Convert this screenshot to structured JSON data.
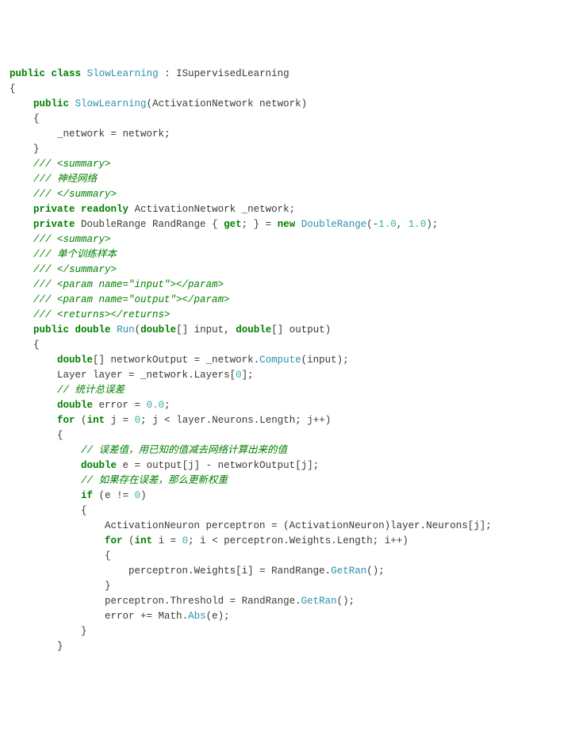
{
  "code": {
    "lines": [
      [
        {
          "c": "kw",
          "t": "public"
        },
        {
          "c": "",
          "t": " "
        },
        {
          "c": "kw",
          "t": "class"
        },
        {
          "c": "",
          "t": " "
        },
        {
          "c": "type",
          "t": "SlowLearning"
        },
        {
          "c": "",
          "t": " "
        },
        {
          "c": "punct",
          "t": ":"
        },
        {
          "c": "",
          "t": " ISupervisedLearning"
        }
      ],
      [
        {
          "c": "punct",
          "t": "{"
        }
      ],
      [
        {
          "c": "",
          "t": "    "
        },
        {
          "c": "kw",
          "t": "public"
        },
        {
          "c": "",
          "t": " "
        },
        {
          "c": "type",
          "t": "SlowLearning"
        },
        {
          "c": "punct",
          "t": "("
        },
        {
          "c": "",
          "t": "ActivationNetwork network"
        },
        {
          "c": "punct",
          "t": ")"
        }
      ],
      [
        {
          "c": "",
          "t": "    "
        },
        {
          "c": "punct",
          "t": "{"
        }
      ],
      [
        {
          "c": "",
          "t": "        _network "
        },
        {
          "c": "op",
          "t": "="
        },
        {
          "c": "",
          "t": " network"
        },
        {
          "c": "punct",
          "t": ";"
        }
      ],
      [
        {
          "c": "",
          "t": "    "
        },
        {
          "c": "punct",
          "t": "}"
        }
      ],
      [
        {
          "c": "",
          "t": ""
        }
      ],
      [
        {
          "c": "",
          "t": "    "
        },
        {
          "c": "comment",
          "t": "/// <summary>"
        }
      ],
      [
        {
          "c": "",
          "t": "    "
        },
        {
          "c": "comment",
          "t": "/// 神经网络"
        }
      ],
      [
        {
          "c": "",
          "t": "    "
        },
        {
          "c": "comment",
          "t": "/// </summary>"
        }
      ],
      [
        {
          "c": "",
          "t": "    "
        },
        {
          "c": "kw",
          "t": "private"
        },
        {
          "c": "",
          "t": " "
        },
        {
          "c": "kw",
          "t": "readonly"
        },
        {
          "c": "",
          "t": " ActivationNetwork _network"
        },
        {
          "c": "punct",
          "t": ";"
        }
      ],
      [
        {
          "c": "",
          "t": ""
        }
      ],
      [
        {
          "c": "",
          "t": "    "
        },
        {
          "c": "kw",
          "t": "private"
        },
        {
          "c": "",
          "t": " DoubleRange RandRange "
        },
        {
          "c": "punct",
          "t": "{"
        },
        {
          "c": "",
          "t": " "
        },
        {
          "c": "kw",
          "t": "get"
        },
        {
          "c": "punct",
          "t": ";"
        },
        {
          "c": "",
          "t": " "
        },
        {
          "c": "punct",
          "t": "}"
        },
        {
          "c": "",
          "t": " "
        },
        {
          "c": "op",
          "t": "="
        },
        {
          "c": "",
          "t": " "
        },
        {
          "c": "kw",
          "t": "new"
        },
        {
          "c": "",
          "t": " "
        },
        {
          "c": "type",
          "t": "DoubleRange"
        },
        {
          "c": "punct",
          "t": "("
        },
        {
          "c": "op",
          "t": "-"
        },
        {
          "c": "num",
          "t": "1.0"
        },
        {
          "c": "punct",
          "t": ","
        },
        {
          "c": "",
          "t": " "
        },
        {
          "c": "num",
          "t": "1.0"
        },
        {
          "c": "punct",
          "t": ")"
        },
        {
          "c": "punct",
          "t": ";"
        }
      ],
      [
        {
          "c": "",
          "t": ""
        }
      ],
      [
        {
          "c": "",
          "t": "    "
        },
        {
          "c": "comment",
          "t": "/// <summary>"
        }
      ],
      [
        {
          "c": "",
          "t": "    "
        },
        {
          "c": "comment",
          "t": "/// 单个训练样本"
        }
      ],
      [
        {
          "c": "",
          "t": "    "
        },
        {
          "c": "comment",
          "t": "/// </summary>"
        }
      ],
      [
        {
          "c": "",
          "t": "    "
        },
        {
          "c": "comment",
          "t": "/// <param name=\"input\"></param>"
        }
      ],
      [
        {
          "c": "",
          "t": "    "
        },
        {
          "c": "comment",
          "t": "/// <param name=\"output\"></param>"
        }
      ],
      [
        {
          "c": "",
          "t": "    "
        },
        {
          "c": "comment",
          "t": "/// <returns></returns>"
        }
      ],
      [
        {
          "c": "",
          "t": "    "
        },
        {
          "c": "kw",
          "t": "public"
        },
        {
          "c": "",
          "t": " "
        },
        {
          "c": "kw",
          "t": "double"
        },
        {
          "c": "",
          "t": " "
        },
        {
          "c": "type",
          "t": "Run"
        },
        {
          "c": "punct",
          "t": "("
        },
        {
          "c": "kw",
          "t": "double"
        },
        {
          "c": "punct",
          "t": "[]"
        },
        {
          "c": "",
          "t": " input"
        },
        {
          "c": "punct",
          "t": ","
        },
        {
          "c": "",
          "t": " "
        },
        {
          "c": "kw",
          "t": "double"
        },
        {
          "c": "punct",
          "t": "[]"
        },
        {
          "c": "",
          "t": " output"
        },
        {
          "c": "punct",
          "t": ")"
        }
      ],
      [
        {
          "c": "",
          "t": "    "
        },
        {
          "c": "punct",
          "t": "{"
        }
      ],
      [
        {
          "c": "",
          "t": "        "
        },
        {
          "c": "kw",
          "t": "double"
        },
        {
          "c": "punct",
          "t": "[]"
        },
        {
          "c": "",
          "t": " networkOutput "
        },
        {
          "c": "op",
          "t": "="
        },
        {
          "c": "",
          "t": " _network"
        },
        {
          "c": "punct",
          "t": "."
        },
        {
          "c": "type",
          "t": "Compute"
        },
        {
          "c": "punct",
          "t": "("
        },
        {
          "c": "",
          "t": "input"
        },
        {
          "c": "punct",
          "t": ")"
        },
        {
          "c": "punct",
          "t": ";"
        }
      ],
      [
        {
          "c": "",
          "t": "        Layer layer "
        },
        {
          "c": "op",
          "t": "="
        },
        {
          "c": "",
          "t": " _network"
        },
        {
          "c": "punct",
          "t": "."
        },
        {
          "c": "",
          "t": "Layers"
        },
        {
          "c": "punct",
          "t": "["
        },
        {
          "c": "num",
          "t": "0"
        },
        {
          "c": "punct",
          "t": "]"
        },
        {
          "c": "punct",
          "t": ";"
        }
      ],
      [
        {
          "c": "",
          "t": "        "
        },
        {
          "c": "comment",
          "t": "// 统计总误差"
        }
      ],
      [
        {
          "c": "",
          "t": "        "
        },
        {
          "c": "kw",
          "t": "double"
        },
        {
          "c": "",
          "t": " error "
        },
        {
          "c": "op",
          "t": "="
        },
        {
          "c": "",
          "t": " "
        },
        {
          "c": "num",
          "t": "0.0"
        },
        {
          "c": "punct",
          "t": ";"
        }
      ],
      [
        {
          "c": "",
          "t": ""
        }
      ],
      [
        {
          "c": "",
          "t": "        "
        },
        {
          "c": "kw",
          "t": "for"
        },
        {
          "c": "",
          "t": " "
        },
        {
          "c": "punct",
          "t": "("
        },
        {
          "c": "kw",
          "t": "int"
        },
        {
          "c": "",
          "t": " j "
        },
        {
          "c": "op",
          "t": "="
        },
        {
          "c": "",
          "t": " "
        },
        {
          "c": "num",
          "t": "0"
        },
        {
          "c": "punct",
          "t": ";"
        },
        {
          "c": "",
          "t": " j "
        },
        {
          "c": "op",
          "t": "<"
        },
        {
          "c": "",
          "t": " layer"
        },
        {
          "c": "punct",
          "t": "."
        },
        {
          "c": "",
          "t": "Neurons"
        },
        {
          "c": "punct",
          "t": "."
        },
        {
          "c": "",
          "t": "Length"
        },
        {
          "c": "punct",
          "t": ";"
        },
        {
          "c": "",
          "t": " j"
        },
        {
          "c": "op",
          "t": "++"
        },
        {
          "c": "punct",
          "t": ")"
        }
      ],
      [
        {
          "c": "",
          "t": "        "
        },
        {
          "c": "punct",
          "t": "{"
        }
      ],
      [
        {
          "c": "",
          "t": "            "
        },
        {
          "c": "comment",
          "t": "// 误差值，用已知的值减去网络计算出来的值"
        }
      ],
      [
        {
          "c": "",
          "t": "            "
        },
        {
          "c": "kw",
          "t": "double"
        },
        {
          "c": "",
          "t": " e "
        },
        {
          "c": "op",
          "t": "="
        },
        {
          "c": "",
          "t": " output"
        },
        {
          "c": "punct",
          "t": "["
        },
        {
          "c": "",
          "t": "j"
        },
        {
          "c": "punct",
          "t": "]"
        },
        {
          "c": "",
          "t": " "
        },
        {
          "c": "op",
          "t": "-"
        },
        {
          "c": "",
          "t": " networkOutput"
        },
        {
          "c": "punct",
          "t": "["
        },
        {
          "c": "",
          "t": "j"
        },
        {
          "c": "punct",
          "t": "]"
        },
        {
          "c": "punct",
          "t": ";"
        }
      ],
      [
        {
          "c": "",
          "t": "            "
        },
        {
          "c": "comment",
          "t": "// 如果存在误差，那么更新权重"
        }
      ],
      [
        {
          "c": "",
          "t": "            "
        },
        {
          "c": "kw",
          "t": "if"
        },
        {
          "c": "",
          "t": " "
        },
        {
          "c": "punct",
          "t": "("
        },
        {
          "c": "",
          "t": "e "
        },
        {
          "c": "op",
          "t": "!="
        },
        {
          "c": "",
          "t": " "
        },
        {
          "c": "num",
          "t": "0"
        },
        {
          "c": "punct",
          "t": ")"
        }
      ],
      [
        {
          "c": "",
          "t": "            "
        },
        {
          "c": "punct",
          "t": "{"
        }
      ],
      [
        {
          "c": "",
          "t": "                ActivationNeuron perceptron "
        },
        {
          "c": "op",
          "t": "="
        },
        {
          "c": "",
          "t": " "
        },
        {
          "c": "punct",
          "t": "("
        },
        {
          "c": "",
          "t": "ActivationNeuron"
        },
        {
          "c": "punct",
          "t": ")"
        },
        {
          "c": "",
          "t": "layer"
        },
        {
          "c": "punct",
          "t": "."
        },
        {
          "c": "",
          "t": "Neurons"
        },
        {
          "c": "punct",
          "t": "["
        },
        {
          "c": "",
          "t": "j"
        },
        {
          "c": "punct",
          "t": "]"
        },
        {
          "c": "punct",
          "t": ";"
        }
      ],
      [
        {
          "c": "",
          "t": ""
        }
      ],
      [
        {
          "c": "",
          "t": "                "
        },
        {
          "c": "kw",
          "t": "for"
        },
        {
          "c": "",
          "t": " "
        },
        {
          "c": "punct",
          "t": "("
        },
        {
          "c": "kw",
          "t": "int"
        },
        {
          "c": "",
          "t": " i "
        },
        {
          "c": "op",
          "t": "="
        },
        {
          "c": "",
          "t": " "
        },
        {
          "c": "num",
          "t": "0"
        },
        {
          "c": "punct",
          "t": ";"
        },
        {
          "c": "",
          "t": " i "
        },
        {
          "c": "op",
          "t": "<"
        },
        {
          "c": "",
          "t": " perceptron"
        },
        {
          "c": "punct",
          "t": "."
        },
        {
          "c": "",
          "t": "Weights"
        },
        {
          "c": "punct",
          "t": "."
        },
        {
          "c": "",
          "t": "Length"
        },
        {
          "c": "punct",
          "t": ";"
        },
        {
          "c": "",
          "t": " i"
        },
        {
          "c": "op",
          "t": "++"
        },
        {
          "c": "punct",
          "t": ")"
        }
      ],
      [
        {
          "c": "",
          "t": "                "
        },
        {
          "c": "punct",
          "t": "{"
        }
      ],
      [
        {
          "c": "",
          "t": "                    perceptron"
        },
        {
          "c": "punct",
          "t": "."
        },
        {
          "c": "",
          "t": "Weights"
        },
        {
          "c": "punct",
          "t": "["
        },
        {
          "c": "",
          "t": "i"
        },
        {
          "c": "punct",
          "t": "]"
        },
        {
          "c": "",
          "t": " "
        },
        {
          "c": "op",
          "t": "="
        },
        {
          "c": "",
          "t": " RandRange"
        },
        {
          "c": "punct",
          "t": "."
        },
        {
          "c": "type",
          "t": "GetRan"
        },
        {
          "c": "punct",
          "t": "()"
        },
        {
          "c": "punct",
          "t": ";"
        }
      ],
      [
        {
          "c": "",
          "t": "                "
        },
        {
          "c": "punct",
          "t": "}"
        }
      ],
      [
        {
          "c": "",
          "t": ""
        }
      ],
      [
        {
          "c": "",
          "t": "                perceptron"
        },
        {
          "c": "punct",
          "t": "."
        },
        {
          "c": "",
          "t": "Threshold "
        },
        {
          "c": "op",
          "t": "="
        },
        {
          "c": "",
          "t": " RandRange"
        },
        {
          "c": "punct",
          "t": "."
        },
        {
          "c": "type",
          "t": "GetRan"
        },
        {
          "c": "punct",
          "t": "()"
        },
        {
          "c": "punct",
          "t": ";"
        }
      ],
      [
        {
          "c": "",
          "t": ""
        }
      ],
      [
        {
          "c": "",
          "t": "                error "
        },
        {
          "c": "op",
          "t": "+="
        },
        {
          "c": "",
          "t": " Math"
        },
        {
          "c": "punct",
          "t": "."
        },
        {
          "c": "type",
          "t": "Abs"
        },
        {
          "c": "punct",
          "t": "("
        },
        {
          "c": "",
          "t": "e"
        },
        {
          "c": "punct",
          "t": ")"
        },
        {
          "c": "punct",
          "t": ";"
        }
      ],
      [
        {
          "c": "",
          "t": "            "
        },
        {
          "c": "punct",
          "t": "}"
        }
      ],
      [
        {
          "c": "",
          "t": "        "
        },
        {
          "c": "punct",
          "t": "}"
        }
      ]
    ]
  }
}
